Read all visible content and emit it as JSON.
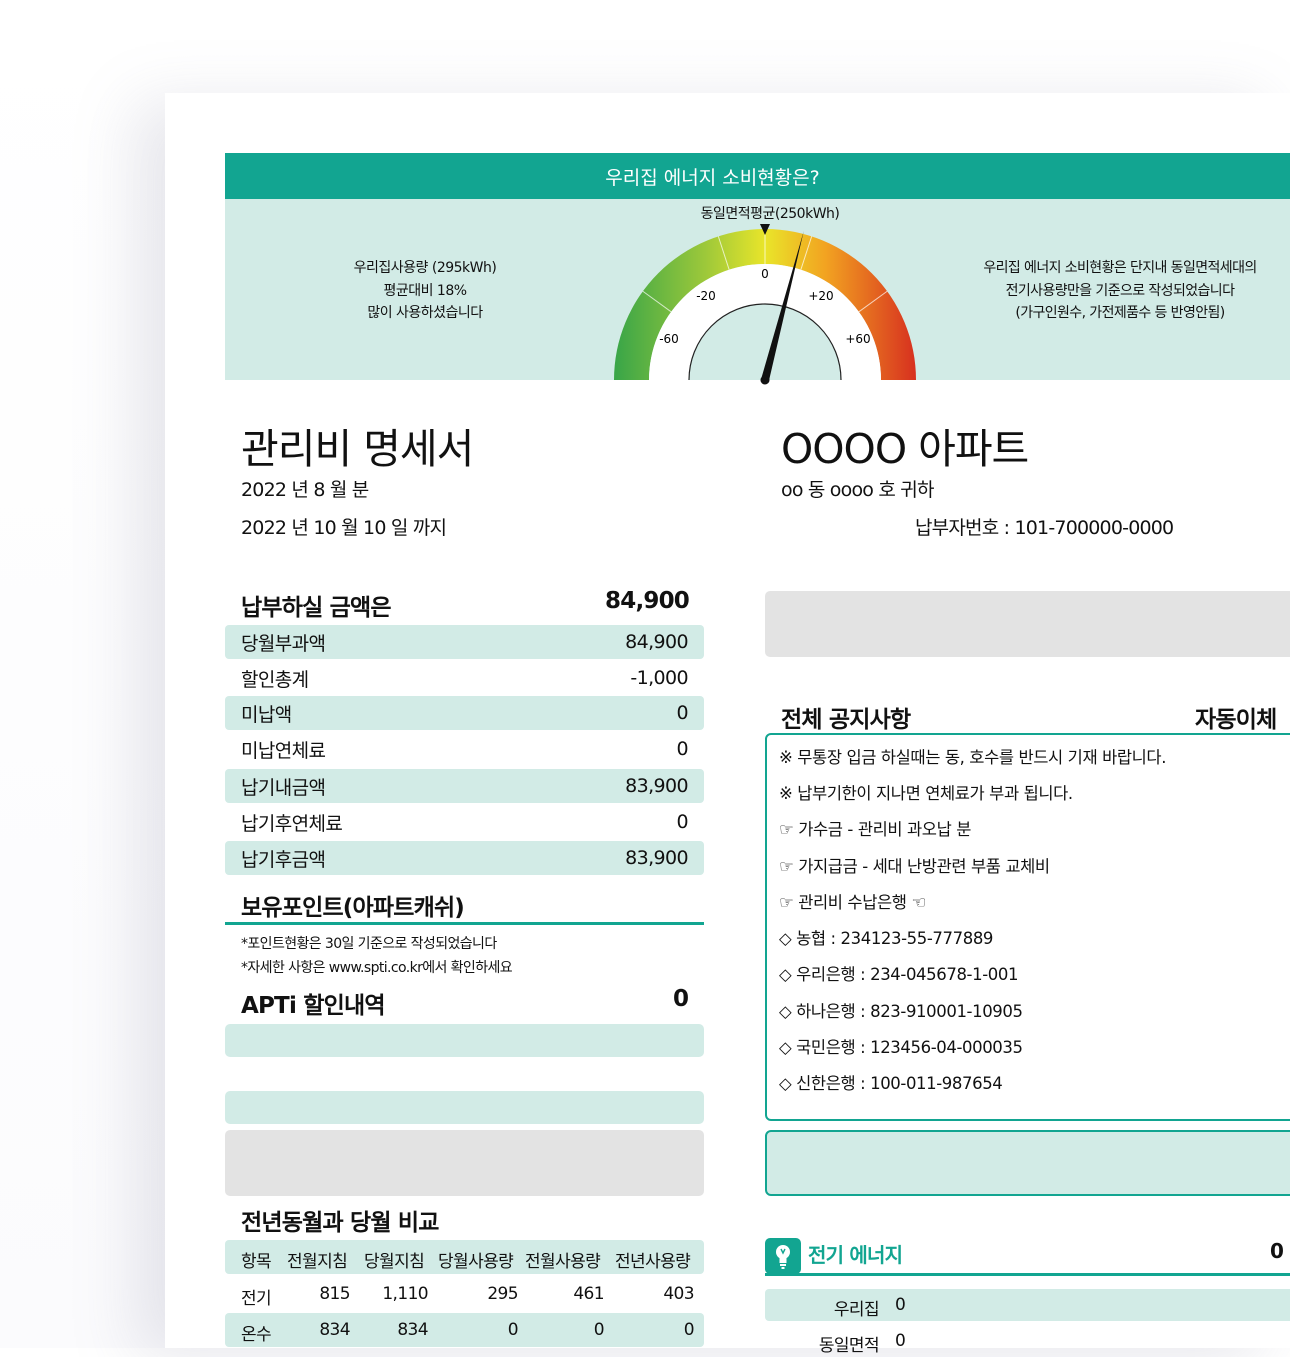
{
  "energy": {
    "header": "우리집 에너지 소비현황은?",
    "avg_label": "동일면적평균(250kWh)",
    "left_text": [
      "우리집사용량 (295kWh)",
      "평균대비 18%",
      "많이 사용하셨습니다"
    ],
    "right_text": [
      "우리집 에너지 소비현황은 단지내 동일면적세대의",
      "전기사용량만을 기준으로 작성되었습니다",
      "(가구인원수, 가전제품수 등 반영안됨)"
    ],
    "ticks": [
      "-60",
      "-20",
      "0",
      "+20",
      "+60"
    ],
    "needle_percent": 18,
    "colors": {
      "teal": "#12a591",
      "mint": "#d2ebe6",
      "green": "#38a548",
      "yellow": "#e9e52a",
      "red": "#d7301f"
    }
  },
  "doc": {
    "title": "관리비 명세서",
    "month": "2022 년 8 월 분",
    "due": "2022 년 10 월 10 일 까지",
    "apartment": "OOOO 아파트",
    "recipient": "oo 동 oooo 호 귀하",
    "payer_no": "납부자번호 : 101-700000-0000"
  },
  "payment": {
    "heading": "납부하실 금액은",
    "total": "84,900",
    "rows": [
      {
        "label": "당월부과액",
        "value": "84,900"
      },
      {
        "label": "할인총계",
        "value": "-1,000"
      },
      {
        "label": "미납액",
        "value": "0"
      },
      {
        "label": "미납연체료",
        "value": "0"
      },
      {
        "label": "납기내금액",
        "value": "83,900"
      },
      {
        "label": "납기후연체료",
        "value": "0"
      },
      {
        "label": "납기후금액",
        "value": "83,900"
      }
    ]
  },
  "points": {
    "heading": "보유포인트(아파트캐쉬)",
    "notes": [
      "*포인트현황은 30일 기준으로 작성되었습니다",
      "*자세한 사항은 www.spti.co.kr에서 확인하세요"
    ]
  },
  "apti": {
    "heading": "APTi 할인내역",
    "value": "0"
  },
  "compare": {
    "heading": "전년동월과 당월 비교",
    "columns": [
      "항목",
      "전월지침",
      "당월지침",
      "당월사용량",
      "전월사용량",
      "전년사용량"
    ],
    "rows": [
      [
        "전기",
        "815",
        "1,110",
        "295",
        "461",
        "403"
      ],
      [
        "온수",
        "834",
        "834",
        "0",
        "0",
        "0"
      ]
    ]
  },
  "notice": {
    "heading": "전체 공지사항",
    "auto_heading": "자동이체",
    "lines": [
      "※ 무통장 입금 하실때는 동, 호수를 반드시 기재 바랍니다.",
      "※ 납부기한이 지나면 연체료가 부과 됩니다.",
      "☞ 가수금 - 관리비 과오납 분",
      "☞ 가지급금 - 세대 난방관련 부품 교체비",
      "☞ 관리비 수납은행 ☜",
      "◇ 농협 : 234123-55-777889",
      "◇ 우리은행 : 234-045678-1-001",
      "◇ 하나은행 : 823-910001-10905",
      "◇ 국민은행 : 123456-04-000035",
      "◇ 신한은행 : 100-011-987654"
    ]
  },
  "electric": {
    "icon": "lightbulb-icon",
    "heading": "전기 에너지",
    "value": "0 ",
    "rows": [
      {
        "label": "우리집",
        "value": "0"
      },
      {
        "label": "동일면적",
        "value": "0"
      }
    ]
  }
}
